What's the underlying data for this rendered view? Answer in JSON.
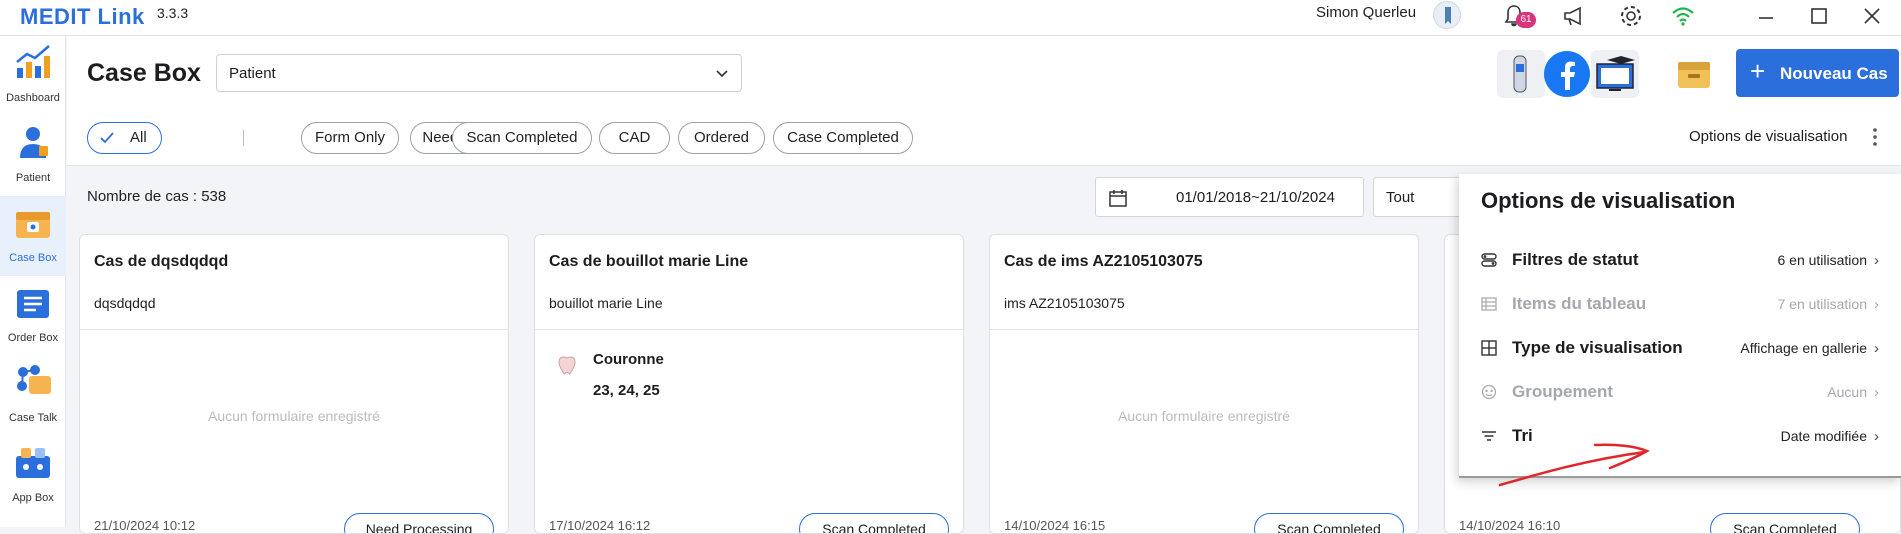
{
  "app": {
    "brand": "MEDIT Link",
    "version": "3.3.3",
    "user": "Simon Querleu",
    "notification_count": "61"
  },
  "sidebar": {
    "items": [
      {
        "label": "Dashboard"
      },
      {
        "label": "Patient"
      },
      {
        "label": "Case Box"
      },
      {
        "label": "Order Box"
      },
      {
        "label": "Case Talk"
      },
      {
        "label": "App Box"
      }
    ]
  },
  "header": {
    "title": "Case Box",
    "search_type": "Patient",
    "new_case_label": "Nouveau Cas",
    "view_options_label": "Options de visualisation"
  },
  "filters": [
    "All",
    "Form Only",
    "Need Processing",
    "Scan Completed",
    "CAD",
    "Ordered",
    "Case Completed"
  ],
  "list": {
    "count_label": "Nombre de cas : 538",
    "date_range": "01/01/2018~21/10/2024",
    "status_filter": "Tout"
  },
  "cards": [
    {
      "title": "Cas de dqsdqdqd",
      "subtitle": "dqsdqdqd",
      "empty": "Aucun formulaire enregistré",
      "date": "21/10/2024 10:12",
      "status": "Need Processing"
    },
    {
      "title": "Cas de bouillot marie Line",
      "subtitle": "bouillot marie Line",
      "form_name": "Couronne",
      "form_teeth": "23, 24, 25",
      "date": "17/10/2024 16:12",
      "status": "Scan Completed"
    },
    {
      "title": "Cas de ims AZ2105103075",
      "subtitle": "ims AZ2105103075",
      "empty": "Aucun formulaire enregistré",
      "date": "14/10/2024 16:15",
      "status": "Scan Completed"
    },
    {
      "date": "14/10/2024 16:10",
      "status": "Scan Completed"
    }
  ],
  "panel": {
    "title": "Options de visualisation",
    "rows": [
      {
        "label": "Filtres de statut",
        "value": "6 en utilisation",
        "enabled": true
      },
      {
        "label": "Items du tableau",
        "value": "7 en utilisation",
        "enabled": false
      },
      {
        "label": "Type de visualisation",
        "value": "Affichage en gallerie",
        "enabled": true
      },
      {
        "label": "Groupement",
        "value": "Aucun",
        "enabled": false
      },
      {
        "label": "Tri",
        "value": "Date modifiée",
        "enabled": true
      }
    ]
  },
  "colors": {
    "accent": "#2b6fdc",
    "badge": "#d9337a",
    "annotation": "#e0262b"
  }
}
